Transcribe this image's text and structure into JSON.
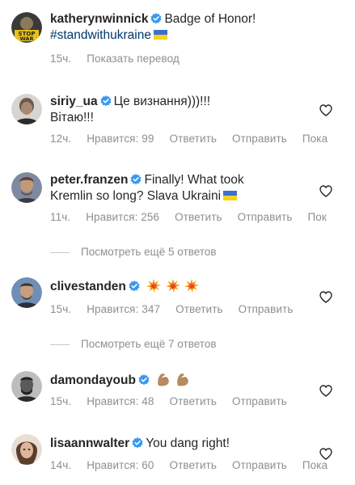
{
  "comments": [
    {
      "username": "katherynwinnick",
      "text": "Badge of Honor!",
      "hashtag": "#standwithukraine",
      "time": "15ч.",
      "translate": "Показать перевод"
    },
    {
      "username": "siriy_ua",
      "text": "Це визнання)))!!!",
      "text2": "Вітаю!!!",
      "time": "12ч.",
      "likes": "Нравится: 99",
      "reply": "Ответить",
      "send": "Отправить",
      "translate": "Пока"
    },
    {
      "username": "peter.franzen",
      "text": "Finally! What took",
      "text2": "Kremlin so long? Slava Ukraini",
      "time": "11ч.",
      "likes": "Нравится: 256",
      "reply": "Ответить",
      "send": "Отправить",
      "translate": "Пок"
    },
    {
      "username": "clivestanden",
      "time": "15ч.",
      "likes": "Нравится: 347",
      "reply": "Ответить",
      "send": "Отправить"
    },
    {
      "username": "damondayoub",
      "time": "15ч.",
      "likes": "Нравится: 48",
      "reply": "Ответить",
      "send": "Отправить"
    },
    {
      "username": "lisaannwalter",
      "text": "You dang right!",
      "time": "14ч.",
      "likes": "Нравится: 60",
      "reply": "Ответить",
      "send": "Отправить",
      "translate": "Пока"
    }
  ],
  "view_replies": [
    "Посмотреть ещё 5 ответов",
    "Посмотреть ещё 7 ответов"
  ],
  "icons": {
    "verified": "verified-badge-icon",
    "like": "heart-outline-icon",
    "flag": "ukraine-flag-emoji",
    "explosion": "collision-emoji",
    "flex": "flexed-biceps-emoji"
  },
  "colors": {
    "verified_blue": "#3897f0",
    "hashtag": "#00376b",
    "secondary_text": "#8e8e8e"
  }
}
